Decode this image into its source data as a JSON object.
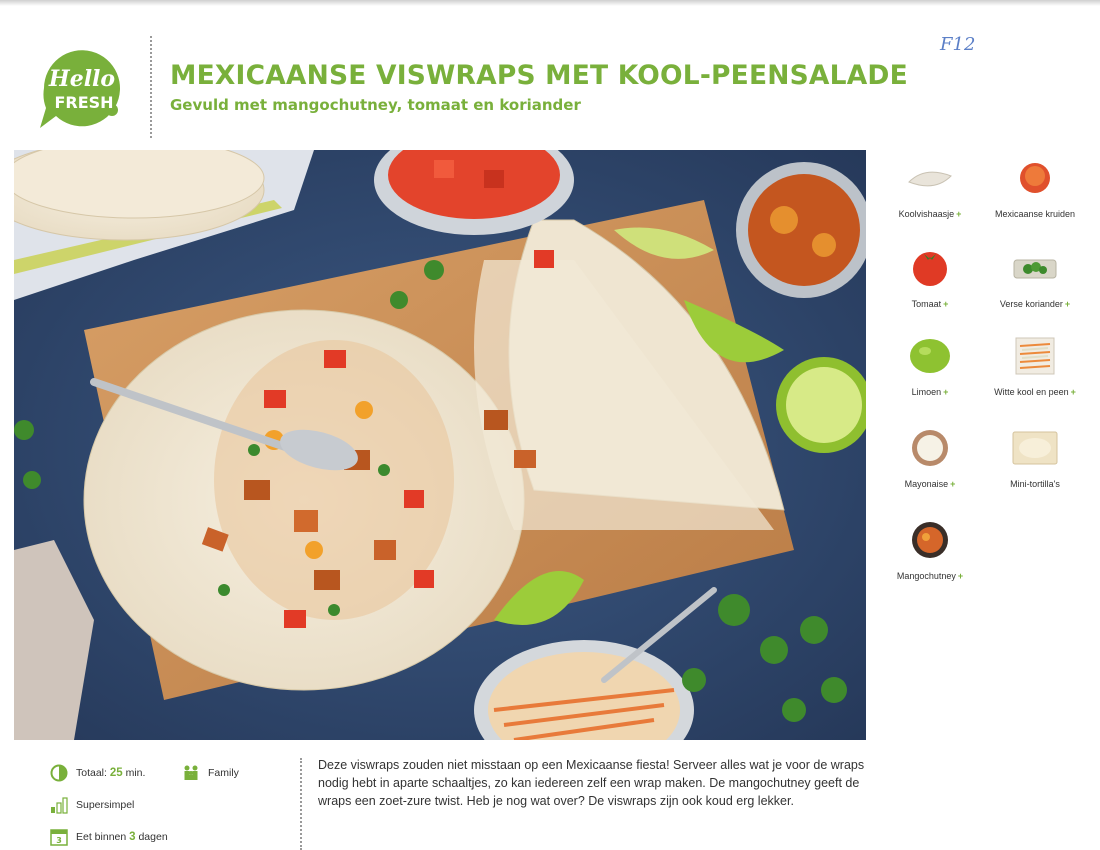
{
  "brand": {
    "line1": "Hello",
    "line2": "FRESH",
    "color": "#79b03b"
  },
  "recipe": {
    "title": "MEXICAANSE VISWRAPS MET KOOL-PEENSALADE",
    "subtitle": "Gevuld met mangochutney, tomaat en koriander"
  },
  "annotation": "F12",
  "ingredients": [
    {
      "label": "Koolvishaasje",
      "icon": "fish-fillet-icon"
    },
    {
      "label": "Mexicaanse kruiden",
      "icon": "spice-mix-icon"
    },
    {
      "label": "Tomaat",
      "icon": "tomato-icon"
    },
    {
      "label": "Verse koriander",
      "icon": "coriander-icon"
    },
    {
      "label": "Limoen",
      "icon": "lime-icon"
    },
    {
      "label": "Witte kool en peen",
      "icon": "cabbage-carrot-icon"
    },
    {
      "label": "Mayonaise",
      "icon": "mayonnaise-icon"
    },
    {
      "label": "Mini-tortilla's",
      "icon": "tortilla-icon"
    },
    {
      "label": "Mangochutney",
      "icon": "mango-chutney-icon"
    }
  ],
  "plus_symbol": "+",
  "meta": {
    "time_label": "Totaal:",
    "time_value": "25",
    "time_unit": "min.",
    "tag": "Family",
    "difficulty": "Supersimpel",
    "eat_within_prefix": "Eet binnen",
    "eat_within_days": "3",
    "eat_within_suffix": "dagen",
    "calendar_number": "3"
  },
  "description": "Deze viswraps zouden niet misstaan op een Mexicaanse fiesta! Serveer alles wat je voor de wraps nodig hebt in aparte schaaltjes, zo kan iedereen zelf een wrap maken. De mangochutney geeft de wraps een zoet-zure twist. Heb je nog wat over? De viswraps zijn ook koud erg lekker.",
  "colors": {
    "accent": "#79b03b",
    "background_table": "#2f4a72",
    "board": "#c98a55"
  }
}
